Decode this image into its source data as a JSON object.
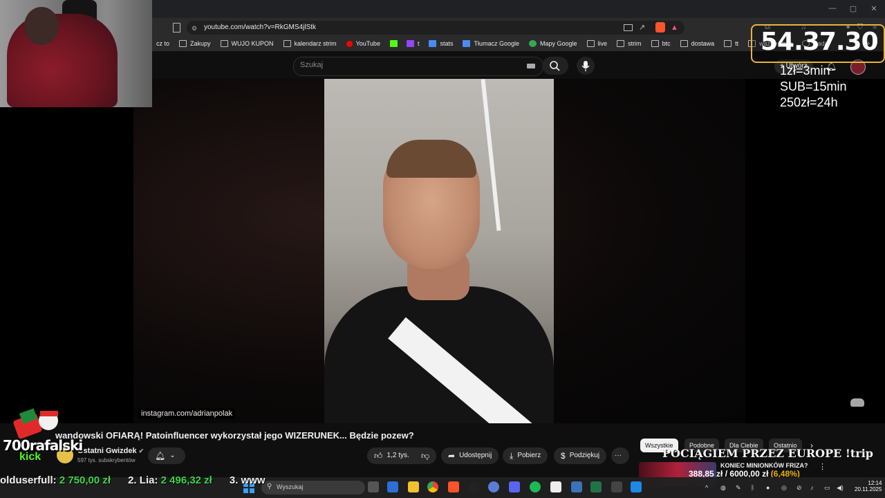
{
  "browser": {
    "url": "youtube.com/watch?v=RkGMS4jlStk",
    "bookmarks": [
      "cz to",
      "Zakupy",
      "WUJO KUPON",
      "kalendarz strim",
      "YouTube",
      "",
      "t",
      "stats",
      "Tłumacz Google",
      "Mapy Google",
      "live",
      "strim",
      "btc",
      "dostawa",
      "tt",
      "ważne strim",
      "Rada",
      "",
      "",
      ""
    ],
    "more_chevron": "»"
  },
  "youtube": {
    "search_placeholder": "Szukaj",
    "create_label": "Utwórz",
    "video_title": "wandowski OFIARĄ! Patoinfluencer wykorzystał jego WIZERUNEK... Będzie pozew?",
    "channel_name": "Ostatni Gwizdek",
    "channel_subs": "597 tys. subskrybentów",
    "like_count": "1,2 tys.",
    "share_label": "Udostępnij",
    "download_label": "Pobierz",
    "thanks_label": "Podziękuj",
    "more_label": "···",
    "video_overlay_label": "instagram.com/adrianpolak",
    "chips": [
      "Wszystkie",
      "Podobne",
      "Dla Ciebie",
      "Ostatnio"
    ],
    "rec_title": "KONIEC MINIONKÓW FRIZA?"
  },
  "stream_overlay": {
    "timer": "54.37.30",
    "rules": [
      "1zł=3min",
      "SUB=15min",
      "250zł=24h"
    ],
    "banner": "POCIĄGIEM PRZEZ EUROPE !trip",
    "donation_amount": "388,85 zł",
    "donation_sep": "/",
    "donation_goal": "6000,00 zł",
    "donation_pct": "(6,48%)",
    "logo_text": "700rafalski",
    "logo_kick": "kick",
    "ticker": [
      {
        "rank": "",
        "name": "olduserfull:",
        "amount": "2 750,00 zł"
      },
      {
        "rank": "2.",
        "name": "Lia:",
        "amount": "2 496,32 zł"
      },
      {
        "rank": "3.",
        "name": "www",
        "amount": ""
      }
    ]
  },
  "taskbar": {
    "search_placeholder": "Wyszukaj",
    "time": "12:14",
    "date": "20.11.2025"
  },
  "colors": {
    "accent_timer_border": "#e8b53a",
    "kick_green": "#53fc18",
    "money_green": "#3fd34a",
    "pct_orange": "#f0b000"
  }
}
